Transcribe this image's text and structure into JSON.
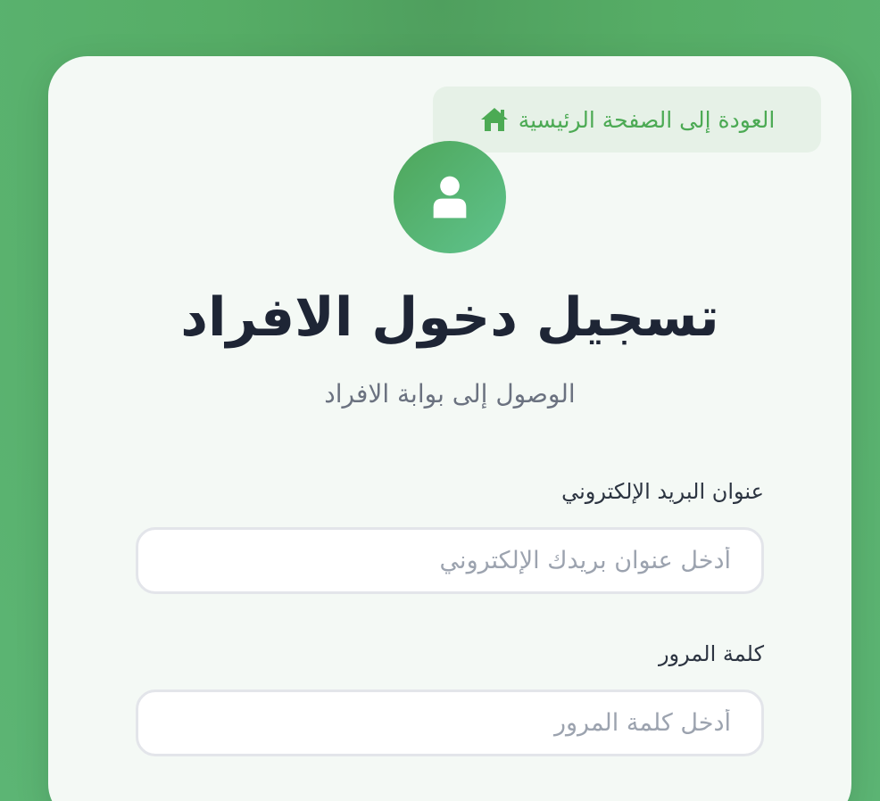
{
  "back_link": {
    "label": "العودة إلى الصفحة الرئيسية",
    "icon": "home-icon"
  },
  "avatar": {
    "icon": "user-icon"
  },
  "title": "تسجيل دخول الافراد",
  "subtitle": "الوصول إلى بوابة الافراد",
  "form": {
    "email": {
      "label": "عنوان البريد الإلكتروني",
      "placeholder": "أدخل عنوان بريدك الإلكتروني",
      "value": ""
    },
    "password": {
      "label": "كلمة المرور",
      "placeholder": "أدخل كلمة المرور",
      "value": ""
    }
  },
  "colors": {
    "background": "#56ad66",
    "card": "#f4f9f5",
    "accent": "#4caa54",
    "title": "#1e2535"
  }
}
